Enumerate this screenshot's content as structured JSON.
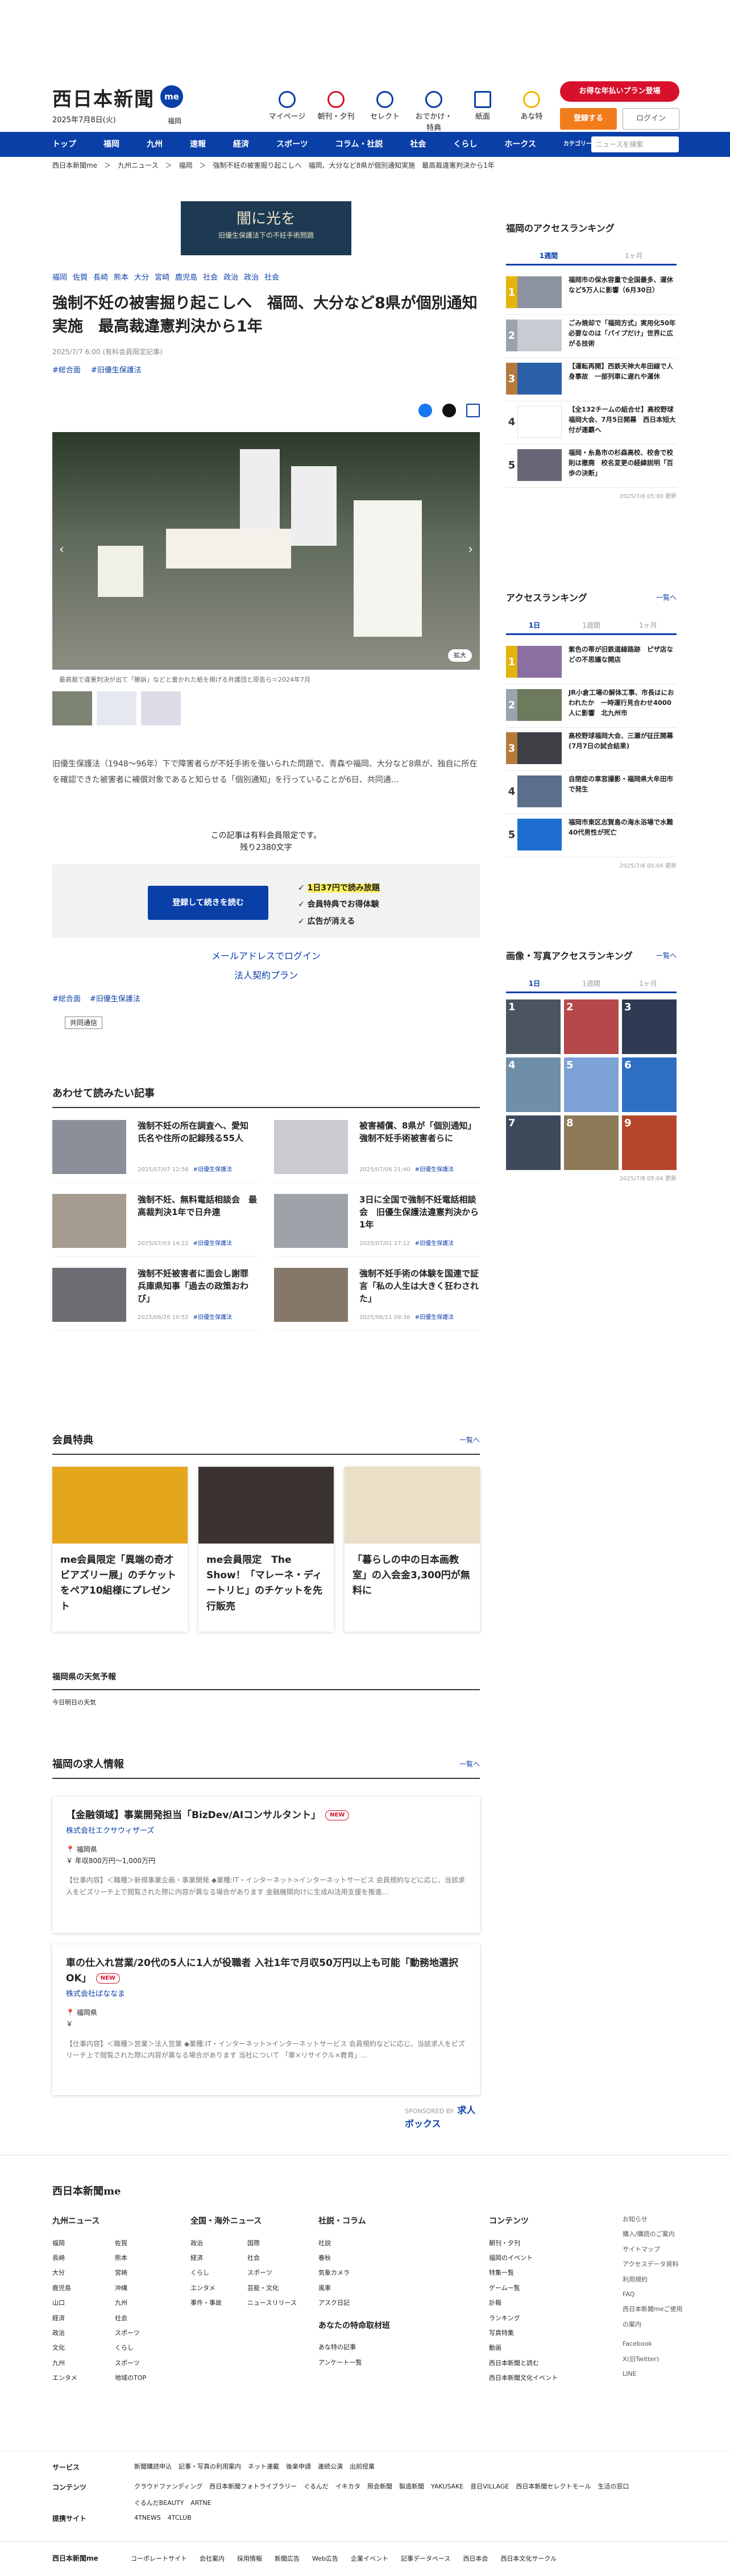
{
  "header": {
    "logo": "西日本新聞",
    "me": "me",
    "date": "2025年7月8日(火)",
    "location": "福岡",
    "icons": [
      "マイページ",
      "朝刊・夕刊",
      "セレクト",
      "おでかけ・特典",
      "紙面",
      "あな特"
    ],
    "promo": "お得な年払いプラン登場",
    "register": "登録する",
    "login": "ログイン"
  },
  "nav": {
    "items": [
      "トップ",
      "福岡",
      "九州",
      "速報",
      "経済",
      "スポーツ",
      "コラム・社説",
      "社会",
      "くらし",
      "ホークス"
    ],
    "category": "カテゴリー ▾",
    "search_placeholder": "ニュースを検索"
  },
  "breadcrumb": "西日本新聞me　＞　九州ニュース　＞　福岡　＞　強制不妊の被害掘り起こしへ　福岡、大分など8県が個別通知実施　最高裁違憲判決から1年",
  "article": {
    "banner_title": "闇に光を",
    "banner_sub": "旧優生保護法下の不妊手術問題",
    "categories": [
      "福岡",
      "佐賀",
      "長崎",
      "熊本",
      "大分",
      "宮崎",
      "鹿児島",
      "社会",
      "政治",
      "政治",
      "社会"
    ],
    "title": "強制不妊の被害掘り起こしへ　福岡、大分など8県が個別通知実施　最高裁違憲判決から1年",
    "meta": "2025/7/7 6:00 (有料会員限定記事)",
    "tags": [
      "#総合面",
      "#旧優生保護法"
    ],
    "caption": "最高裁で違憲判決が出て「勝訴」などと書かれた紙を掲げる弁護団と原告ら＝2024年7月",
    "zoom": "拡大",
    "lead": "旧優生保護法（1948～96年）下で障害者らが不妊手術を強いられた問題で、青森や福岡、大分など8県が、独自に所在を確認できた被害者に補償対象であると知らせる「個別通知」を行っていることが6日、共同通…",
    "paid": "この記事は有料会員限定です。",
    "remaining": "残り2380文字",
    "pay_button": "登録して続きを読む",
    "benefits": [
      "1日37円で読み放題",
      "会員特典でお得体験",
      "広告が消える"
    ],
    "mail_login": "メールアドレスでログイン",
    "corp": "法人契約プラン",
    "tags2": [
      "#総合面",
      "#旧優生保護法"
    ],
    "cotag": "共同通信"
  },
  "related": {
    "title": "あわせて読みたい記事",
    "items": [
      {
        "title": "強制不妊の所在調査へ、愛知　氏名や住所の記録残る55人",
        "date": "2025/07/07 12:56",
        "tag": "#旧優生保護法"
      },
      {
        "title": "被害補償、8県が「個別通知」強制不妊手術被害者らに",
        "date": "2025/07/06 21:40",
        "tag": "#旧優生保護法"
      },
      {
        "title": "強制不妊、無料電話相談会　最高裁判決1年で日弁連",
        "date": "2025/07/03 14:22",
        "tag": "#旧優生保護法"
      },
      {
        "title": "3日に全国で強制不妊電話相談会　旧優生保護法違憲判決から1年",
        "date": "2025/07/01 17:12",
        "tag": "#旧優生保護法"
      },
      {
        "title": "強制不妊被害者に面会し謝罪　兵庫県知事「過去の政策おわび」",
        "date": "2025/06/26 10:52",
        "tag": "#旧優生保護法"
      },
      {
        "title": "強制不妊手術の体験を国連で証言「私の人生は大きく狂わされた」",
        "date": "2025/06/11 09:36",
        "tag": "#旧優生保護法"
      }
    ]
  },
  "perks": {
    "title": "会員特典",
    "more": "一覧へ",
    "items": [
      "me会員限定「異端の奇才 ビアズリー展」のチケットをペア10組様にプレゼント",
      "me会員限定　The Show！「マレーネ・ディートリヒ」のチケットを先行販売",
      "「暮らしの中の日本画教室」の入会金3,300円が無料に"
    ]
  },
  "weather": {
    "title": "福岡県の天気予報",
    "sub": "今日明日の天気"
  },
  "jobs": {
    "title": "福岡の求人情報",
    "more": "一覧へ",
    "items": [
      {
        "title": "【金融領域】事業開発担当「BizDev/AIコンサルタント」",
        "new": "NEW",
        "company": "株式会社エクサウィザーズ",
        "loc": "福岡県",
        "salary": "年収800万円～1,000万円",
        "desc": "【仕事内容】＜職種＞新規事業企画・事業開発 ◆業種:IT・インターネット>インターネットサービス 会員規約などに応じ、当該求人をピズリーチ上で閲覧された際に内容が異なる場合があります 金融機関向けに生成AI活用支援を推進…"
      },
      {
        "title": "車の仕入れ営業/20代の5人に1人が役職者 入社1年で月収50万円以上も可能「動務地選択OK」",
        "new": "NEW",
        "company": "株式会社ばななま",
        "loc": "福岡県",
        "salary": "",
        "desc": "【仕事内容】＜職種＞営業＞法人営業 ◆業種:IT・インターネット>インターネットサービス 会員規約などに応じ、当該求人をピズリーチ上で閲覧された際に内容が異なる場合があります 当社について 「車×リサイクル×教育」…"
      }
    ],
    "sponsor": "SPONSORED BY",
    "sponsor_name": "求人ボックス"
  },
  "sidebar": {
    "access": {
      "title": "福岡のアクセスランキング",
      "tabs": [
        "1週間",
        "1ヶ月"
      ],
      "updated": "2025/7/8 05:00 更新",
      "items": [
        "ごみ焼却で「福岡方式」実用化50年　必要なのは「パイプだけ」世界に広がる技術",
        "【運転再開】西鉄天神大牟田線で人身事故　一部列車に遅れや運休",
        "【全132チームの組合せ】高校野球福岡大会、7月5日開幕　西日本短大付が連覇へ",
        "福岡・糸島市の杉森高校、校舎で校則は撤廃　校名変更の経緯説明「百歩の決断」",
        "福岡市の保水容量で全国最多、運休など5万人に影響（6月30日）"
      ]
    },
    "access2": {
      "title": "アクセスランキング",
      "more": "一覧へ",
      "tabs": [
        "1日",
        "1週間",
        "1ヶ月"
      ],
      "updated": "2025/7/8 05:04 更新",
      "items": [
        "紫色の帯が旧鉄道線路跡　ピザ店などの不思議な開店",
        "JR小倉工場の解体工事、市長はにおわれたか　一時運行見合わせ4000人に影響　北九州市",
        "高校野球福岡大会、三瀬が征圧開幕(7月7日の試合結果)",
        "自閉症の車窓撮影・福岡県大牟田市で発生",
        "福岡市東区志賀島の海水浴場で水難　40代男性が死亡"
      ]
    },
    "photo": {
      "title": "画像・写真アクセスランキング",
      "more": "一覧へ",
      "tabs": [
        "1日",
        "1週間",
        "1ヶ月"
      ],
      "updated": "2025/7/8 05:04 更新"
    }
  },
  "footer": {
    "logo": "西日本新聞me",
    "kyushu": {
      "h": "九州ニュース",
      "items": [
        "福岡",
        "佐賀",
        "長崎",
        "熊本",
        "大分",
        "宮崎",
        "鹿児島",
        "沖縄",
        "山口",
        "九州",
        "経済",
        "社会",
        "政治",
        "スポーツ",
        "文化",
        "くらし",
        "九州",
        "スポーツ",
        "エンタメ",
        "地域のTOP"
      ]
    },
    "national": {
      "h": "全国・海外ニュース",
      "items": [
        "政治",
        "国際",
        "経済",
        "社会",
        "くらし",
        "スポーツ",
        "エンタメ",
        "芸能・文化",
        "事件・事故",
        "ニュースリリース"
      ]
    },
    "column": {
      "h": "社説・コラム",
      "items": [
        "社説",
        "春秋",
        "気象カメラ",
        "風車",
        "アスク日記"
      ]
    },
    "anatoku": {
      "h": "あなたの特命取材班",
      "items": [
        "あな特の記事",
        "アンケート一覧"
      ]
    },
    "contents": {
      "h": "コンテンツ",
      "items": [
        "朝刊・夕刊",
        "福岡のイベント",
        "特集一覧",
        "ゲーム一覧",
        "訃報",
        "ランキング",
        "写真特集",
        "動画",
        "西日本新聞と読む",
        "西日本新聞文化イベント"
      ]
    },
    "misc": [
      "お知らせ",
      "購入/購読のご案内",
      "サイトマップ",
      "アクセスデータ資料",
      "利用規約",
      "FAQ",
      "西日本新聞meご使用の案内"
    ],
    "social": [
      "Facebook",
      "X(旧Twitter)",
      "LINE"
    ],
    "rows": [
      {
        "h": "サービス",
        "items": [
          "新聞購読申込",
          "記事・写真の利用案内",
          "ネット連載",
          "後楽申請",
          "連続公演",
          "出前授業"
        ]
      },
      {
        "h": "コンテンツ",
        "items": [
          "クラウドファンディング",
          "西日本新聞フォトライブラリー",
          "ぐるんだ",
          "イキカタ",
          "照会新聞",
          "製造新聞",
          "YAKUSAKE",
          "音日VILLAGE",
          "西日本新聞セレクトモール",
          "生活の窓口",
          "ぐるんだBEAUTY",
          "ARTNE"
        ]
      },
      {
        "h": "提携サイト",
        "items": [
          "4TNEWS",
          "4TCLUB"
        ]
      }
    ],
    "bottom": [
      "コーポレートサイト",
      "会社案内",
      "採用情報",
      "新聞広告",
      "Web広告",
      "企業イベント",
      "記事データベース",
      "西日本会",
      "西日本文化サークル"
    ]
  }
}
